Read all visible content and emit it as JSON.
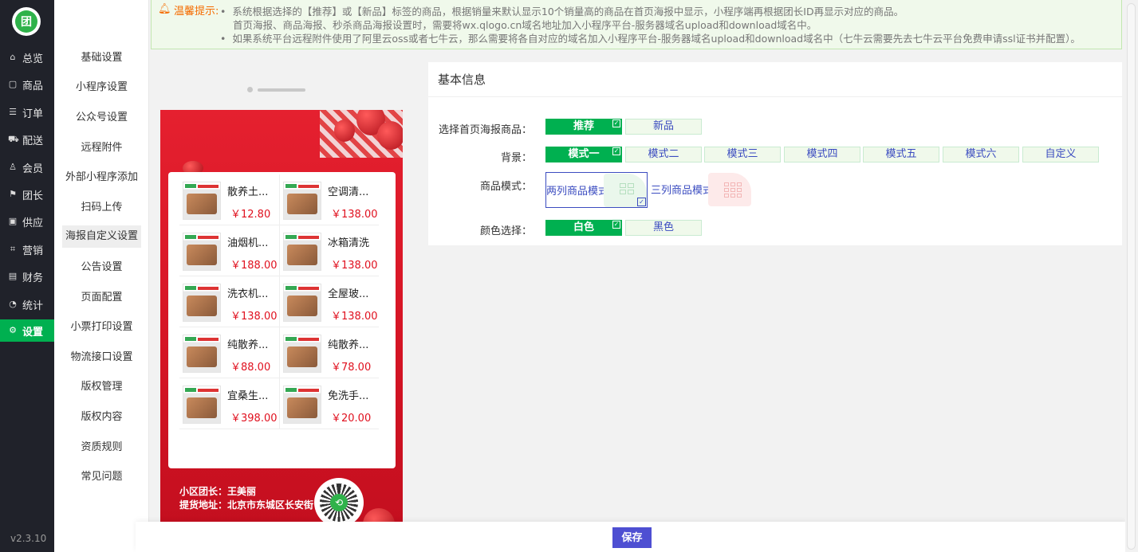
{
  "app": {
    "logo_text": "团",
    "version": "v2.3.10"
  },
  "nav": [
    {
      "label": "总览",
      "icon": "home-icon",
      "glyph": "⌂"
    },
    {
      "label": "商品",
      "icon": "box-icon",
      "glyph": "▢"
    },
    {
      "label": "订单",
      "icon": "list-icon",
      "glyph": "☰"
    },
    {
      "label": "配送",
      "icon": "truck-icon",
      "glyph": "⛟"
    },
    {
      "label": "会员",
      "icon": "user-icon",
      "glyph": "♙"
    },
    {
      "label": "团长",
      "icon": "leader-icon",
      "glyph": "⚑"
    },
    {
      "label": "供应",
      "icon": "supply-icon",
      "glyph": "▣"
    },
    {
      "label": "营销",
      "icon": "gift-icon",
      "glyph": "⌗"
    },
    {
      "label": "财务",
      "icon": "finance-icon",
      "glyph": "▤"
    },
    {
      "label": "统计",
      "icon": "stats-icon",
      "glyph": "◔"
    },
    {
      "label": "设置",
      "icon": "gear-icon",
      "glyph": "⚙"
    }
  ],
  "submenu": [
    "基础设置",
    "小程序设置",
    "公众号设置",
    "远程附件",
    "外部小程序添加",
    "扫码上传",
    "海报自定义设置",
    "公告设置",
    "页面配置",
    "小票打印设置",
    "物流接口设置",
    "版权管理",
    "版权内容",
    "资质规则",
    "常见问题"
  ],
  "notice": {
    "title": "温馨提示:",
    "lines": [
      "系统根据选择的【推荐】或【新品】标签的商品，根据销量来默认显示10个销量高的商品在首页海报中显示，小程序端再根据团长ID再显示对应的商品。",
      "首页海报、商品海报、秒杀商品海报设置时，需要将wx.qlogo.cn域名地址加入小程序平台-服务器域名upload和download域名中。",
      "如果系统平台远程附件使用了阿里云oss或者七牛云，那么需要将各自对应的域名加入小程序平台-服务器域名upload和download域名中（七牛云需要先去七牛云平台免费申请ssl证书并配置）。"
    ]
  },
  "poster": {
    "products": [
      {
        "name": "散养土...",
        "price": "￥12.80"
      },
      {
        "name": "空调清...",
        "price": "￥138.00"
      },
      {
        "name": "油烟机...",
        "price": "￥188.00"
      },
      {
        "name": "冰箱清洗",
        "price": "￥138.00"
      },
      {
        "name": "洗衣机...",
        "price": "￥138.00"
      },
      {
        "name": "全屋玻...",
        "price": "￥138.00"
      },
      {
        "name": "纯散养...",
        "price": "￥88.00"
      },
      {
        "name": "纯散养...",
        "price": "￥78.00"
      },
      {
        "name": "宜桑生...",
        "price": "￥398.00"
      },
      {
        "name": "免洗手...",
        "price": "￥20.00"
      }
    ],
    "leader": "小区团长：王美丽",
    "address": "提货地址：北京市东城区长安街"
  },
  "settings": {
    "title": "基本信息",
    "poster_goods_label": "选择首页海报商品：",
    "poster_goods_options": [
      "推荐",
      "新品"
    ],
    "background_label": "背景：",
    "background_options": [
      "模式一",
      "模式二",
      "模式三",
      "模式四",
      "模式五",
      "模式六",
      "自定义"
    ],
    "goods_mode_label": "商品模式：",
    "goods_mode_options": [
      "两列商品模式",
      "三列商品模式"
    ],
    "color_label": "颜色选择：",
    "color_options": [
      "白色",
      "黑色"
    ],
    "selected": {
      "poster_goods": "推荐",
      "background": "模式一",
      "goods_mode": "两列商品模式",
      "color": "白色"
    }
  },
  "footer": {
    "save_label": "保存"
  },
  "colors": {
    "accent": "#00b050",
    "nav_bg": "#20222a",
    "primary_button": "#4e4fd2",
    "price": "#e0101e"
  }
}
